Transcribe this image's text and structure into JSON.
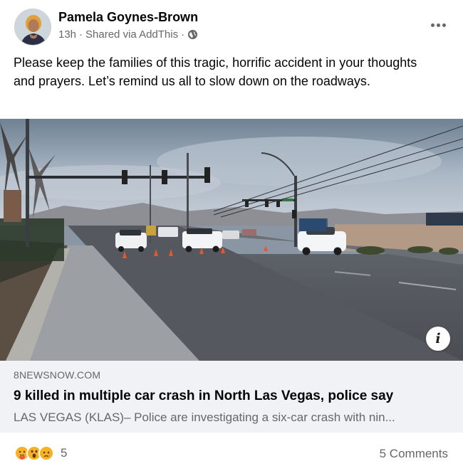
{
  "post": {
    "author": "Pamela Goynes-Brown",
    "time": "13h",
    "shared_via": "Shared via AddThis",
    "separator": "·",
    "privacy_icon": "globe-icon",
    "more_icon": "more-options-icon",
    "text": "Please keep the families of this tragic, horrific accident in your thoughts and prayers. Let’s remind us all to slow down on the roadways."
  },
  "link_preview": {
    "domain": "8NEWSNOW.COM",
    "title": "9 killed in multiple car crash in North Las Vegas, police say",
    "description": "LAS VEGAS (KLAS)– Police are investigating a six-car crash with nin...",
    "info_icon": "info-icon",
    "info_label": "i"
  },
  "footer": {
    "reaction_icons": [
      "care-icon",
      "wow-icon",
      "sad-icon"
    ],
    "reaction_count": "5",
    "comments": "5 Comments"
  },
  "colors": {
    "text_primary": "#050505",
    "text_secondary": "#65676b",
    "link_bg": "#f0f2f5"
  }
}
